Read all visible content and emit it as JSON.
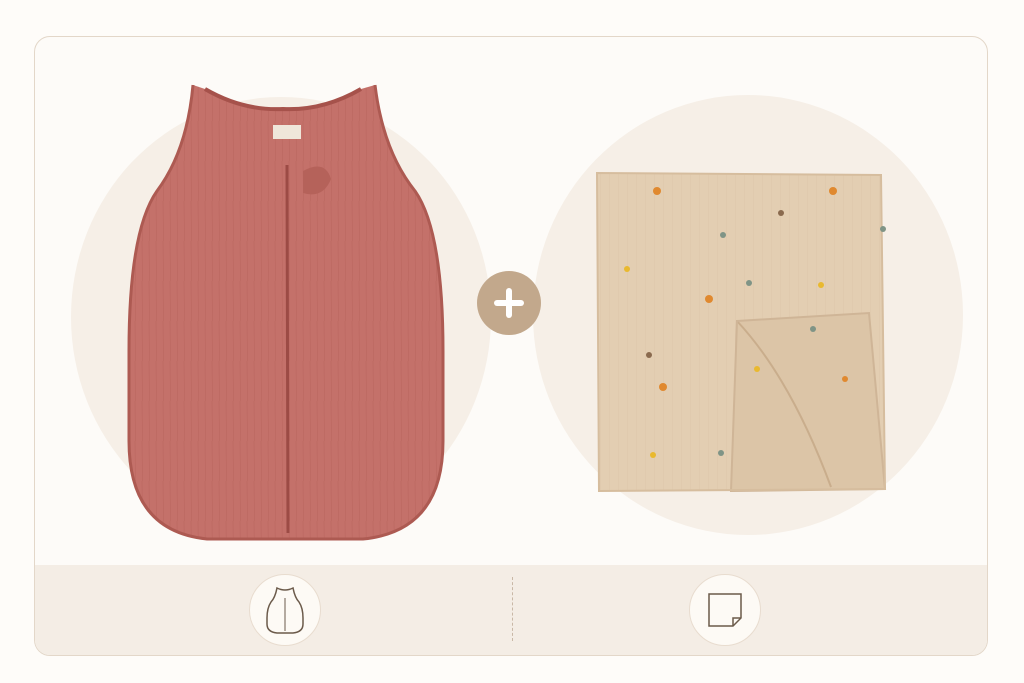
{
  "products": [
    {
      "name": "sleeping-bag",
      "color": "#c26f66",
      "icon": "sleeping-bag-icon"
    },
    {
      "name": "muslin-blanket",
      "color": "#e2cdb1",
      "icon": "blanket-icon"
    }
  ],
  "accent_color": "#c2a88c",
  "plus_icon": "plus-icon"
}
